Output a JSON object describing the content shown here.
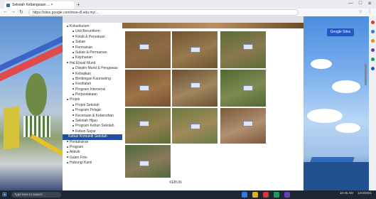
{
  "browser": {
    "tab_title": "Sekolah Kebangsaan ... × ",
    "new_tab": "+",
    "window_controls": [
      "—",
      "□",
      "✕"
    ],
    "url": "https://sites.google.com/moe-dl.edu.my/...",
    "nav_icons": [
      "←",
      "→",
      "↻"
    ],
    "toolbar_icons": [
      "☆",
      "⋮"
    ]
  },
  "site": {
    "action_button": "Google Sites",
    "caption": "KEBUN"
  },
  "nav": {
    "items": [
      {
        "label": "Kokurikulum",
        "depth": 1
      },
      {
        "label": "Unit Beruniform",
        "depth": 2
      },
      {
        "label": "Kelab & Persatuan",
        "depth": 2
      },
      {
        "label": "Sukan",
        "depth": 2
      },
      {
        "label": "Permainan",
        "depth": 2
      },
      {
        "label": "Sukan & Permainan",
        "depth": 2
      },
      {
        "label": "Kejohanan",
        "depth": 2
      },
      {
        "label": "Hal Ehwal Murid",
        "depth": 1
      },
      {
        "label": "Disiplin Murid & Pengawas",
        "depth": 2
      },
      {
        "label": "Kebajikan",
        "depth": 2
      },
      {
        "label": "Bimbingan Kaunseling",
        "depth": 2
      },
      {
        "label": "Kesihatan",
        "depth": 2
      },
      {
        "label": "Program Intervensi",
        "depth": 2
      },
      {
        "label": "Perpustakaan",
        "depth": 2
      },
      {
        "label": "Projek",
        "depth": 1
      },
      {
        "label": "Projek Sekolah",
        "depth": 2
      },
      {
        "label": "Program Pelajar",
        "depth": 2
      },
      {
        "label": "Keceriaan & Kebersihan",
        "depth": 2
      },
      {
        "label": "Sekolah Hijau",
        "depth": 2
      },
      {
        "label": "Program Kebun Sekolah",
        "depth": 2
      },
      {
        "label": "Kebun Sayur",
        "depth": 2
      },
      {
        "label": "Kebun Komuniti Sekolah",
        "depth": 1,
        "active": true
      },
      {
        "label": "Pentaksiran",
        "depth": 1
      },
      {
        "label": "Program",
        "depth": 1
      },
      {
        "label": "Aktiviti",
        "depth": 1
      },
      {
        "label": "Galeri Foto",
        "depth": 1
      },
      {
        "label": "Hubungi Kami",
        "depth": 1
      }
    ]
  },
  "taskbar": {
    "search_placeholder": "Type here to search",
    "time": "10:45 AM",
    "date": "12/3/2021"
  },
  "colors": {
    "accent": "#2457c5",
    "nav_active": "#1f4fa3",
    "taskbar": "#1c2733"
  }
}
